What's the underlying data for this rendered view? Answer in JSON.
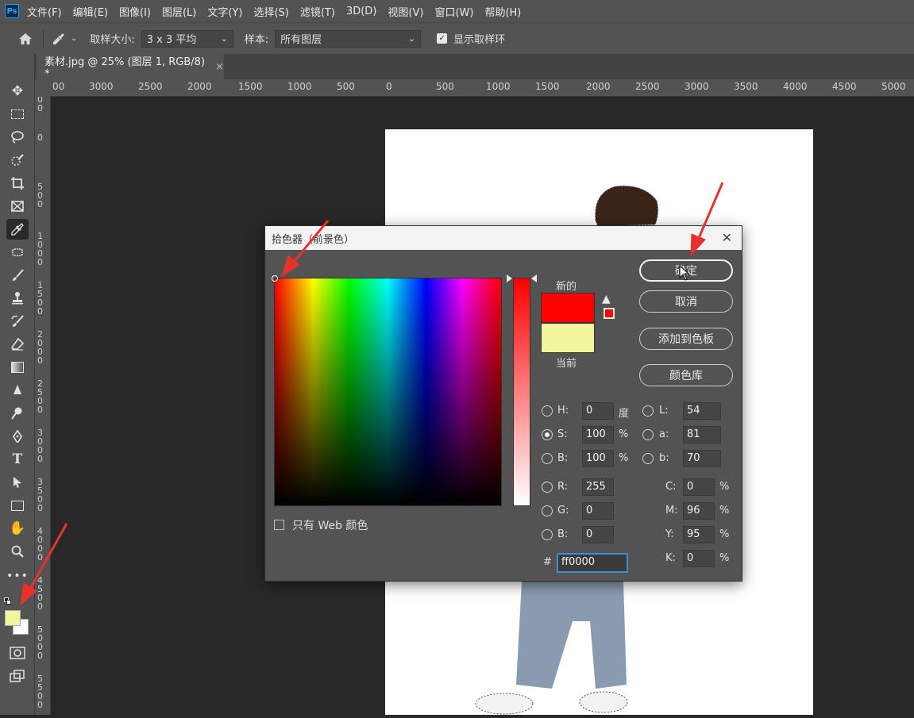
{
  "menubar": {
    "logo": "Ps",
    "items": [
      "文件(F)",
      "编辑(E)",
      "图像(I)",
      "图层(L)",
      "文字(Y)",
      "选择(S)",
      "滤镜(T)",
      "3D(D)",
      "视图(V)",
      "窗口(W)",
      "帮助(H)"
    ]
  },
  "options": {
    "sample_size_label": "取样大小:",
    "sample_size_value": "3 x 3 平均",
    "sample_label": "样本:",
    "sample_value": "所有图层",
    "show_ring_label": "显示取样环"
  },
  "tab": {
    "title": "素材.jpg @ 25% (图层 1, RGB/8) *",
    "close": "×"
  },
  "ruler": {
    "h_labels": [
      "00",
      "3000",
      "2500",
      "2000",
      "1500",
      "1000",
      "500",
      "0",
      "500",
      "1000",
      "1500",
      "2000",
      "2500",
      "3000",
      "3500",
      "4000",
      "4500",
      "5000"
    ],
    "v_labels": [
      "0\n0",
      "0",
      "5\n0\n0",
      "1\n0\n0\n0",
      "1\n5\n0\n0",
      "2\n0\n0\n0",
      "2\n5\n0\n0",
      "3\n0\n0\n0",
      "3\n5\n0\n0",
      "4\n0\n0\n0",
      "4\n5\n0\n0",
      "5\n0\n0\n0",
      "5\n5\n0\n0"
    ]
  },
  "dialog": {
    "title": "拾色器（前景色）",
    "new_label": "新的",
    "current_label": "当前",
    "new_color": "#ff0000",
    "current_color": "#f0f59e",
    "buttons": {
      "ok": "确定",
      "cancel": "取消",
      "add_swatch": "添加到色板",
      "color_library": "颜色库"
    },
    "web_only_label": "只有 Web 颜色",
    "hsb": {
      "h_label": "H:",
      "h_value": "0",
      "h_unit": "度",
      "s_label": "S:",
      "s_value": "100",
      "s_unit": "%",
      "b_label": "B:",
      "b_value": "100",
      "b_unit": "%"
    },
    "rgb": {
      "r_label": "R:",
      "r_value": "255",
      "g_label": "G:",
      "g_value": "0",
      "b_label": "B:",
      "b_value": "0"
    },
    "lab": {
      "l_label": "L:",
      "l_value": "54",
      "a_label": "a:",
      "a_value": "81",
      "b_label": "b:",
      "b_value": "70"
    },
    "cmyk": {
      "c_label": "C:",
      "c_value": "0",
      "m_label": "M:",
      "m_value": "96",
      "y_label": "Y:",
      "y_value": "95",
      "k_label": "K:",
      "k_value": "0",
      "unit": "%"
    },
    "hex_label": "#",
    "hex_value": "ff0000"
  },
  "colors": {
    "foreground": "#f0f59e",
    "background": "#ffffff",
    "annotation": "#e8312a"
  }
}
